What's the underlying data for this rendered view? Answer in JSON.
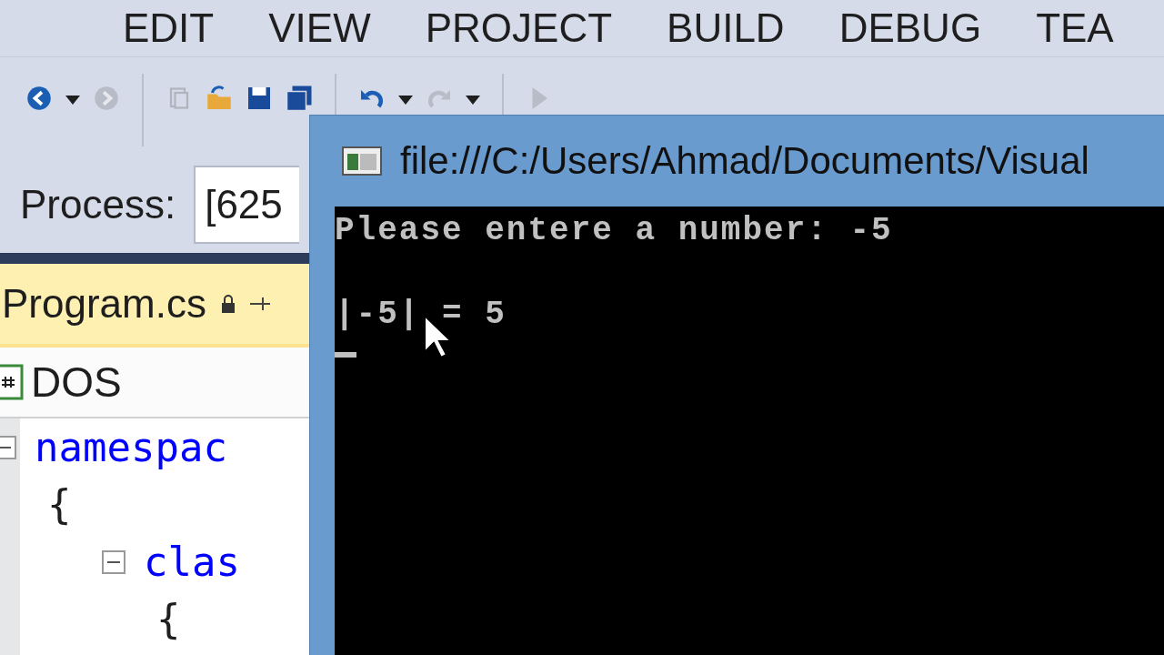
{
  "menu": [
    "EDIT",
    "VIEW",
    "PROJECT",
    "BUILD",
    "DEBUG",
    "TEA"
  ],
  "process": {
    "label": "Process:",
    "value": "[625"
  },
  "tab": {
    "label": "Program.cs"
  },
  "navigation": {
    "project": "DOS"
  },
  "code": {
    "blocks": [
      {
        "keyword": "namespac",
        "brace": "{",
        "expanded": true,
        "children": [
          {
            "keyword": "clas",
            "brace": "{",
            "expanded": true
          }
        ]
      }
    ]
  },
  "console": {
    "title": "file:///C:/Users/Ahmad/Documents/Visual",
    "lines": [
      "Please entere a number: -5",
      "|-5| = 5"
    ]
  }
}
